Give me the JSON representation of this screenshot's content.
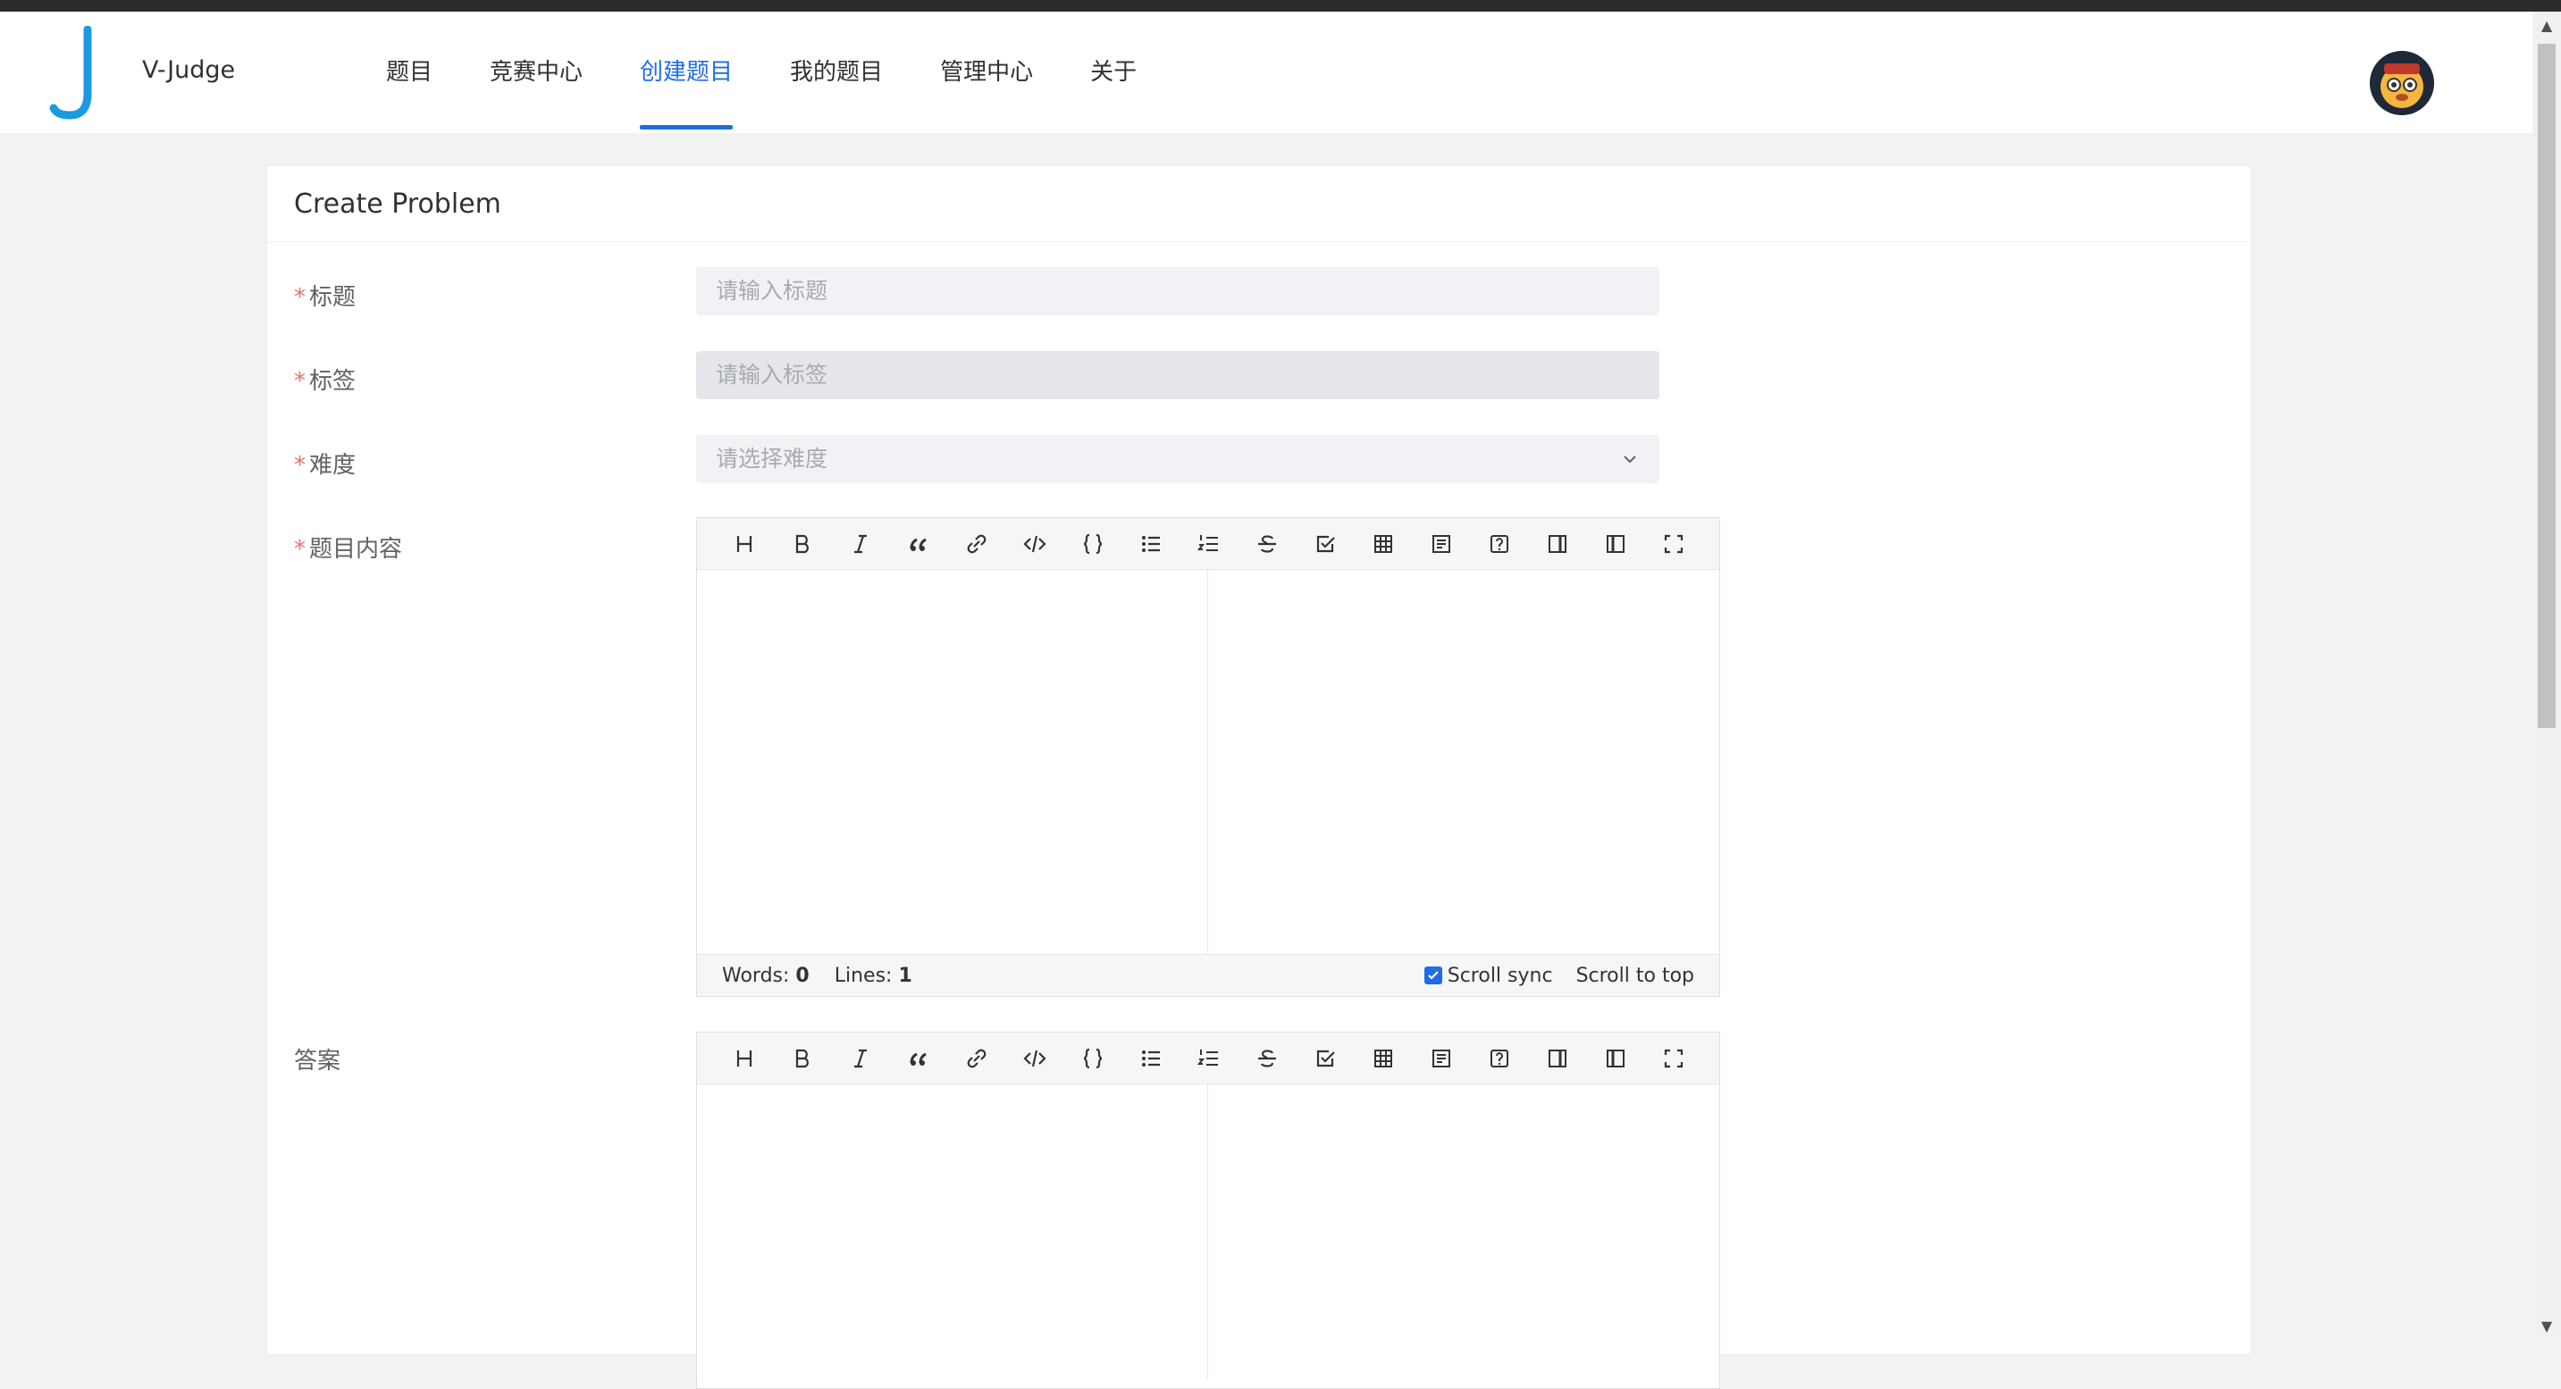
{
  "app": {
    "name": "V-Judge"
  },
  "nav": {
    "items": [
      {
        "label": "题目"
      },
      {
        "label": "竞赛中心"
      },
      {
        "label": "创建题目"
      },
      {
        "label": "我的题目"
      },
      {
        "label": "管理中心"
      },
      {
        "label": "关于"
      }
    ],
    "active": "创建题目"
  },
  "card": {
    "title": "Create Problem"
  },
  "form": {
    "title": {
      "label": "标题",
      "placeholder": "请输入标题",
      "required": true
    },
    "tags": {
      "label": "标签",
      "placeholder": "请输入标签",
      "required": true
    },
    "difficulty": {
      "label": "难度",
      "placeholder": "请选择难度",
      "required": true
    },
    "content": {
      "label": "题目内容",
      "required": true
    },
    "answer": {
      "label": "答案",
      "required": false
    },
    "required_mark": "*"
  },
  "editor": {
    "toolbar": [
      "heading",
      "bold",
      "italic",
      "quote",
      "link",
      "code",
      "code-block",
      "unordered-list",
      "ordered-list",
      "strikethrough",
      "task-list",
      "table",
      "preview",
      "help",
      "side-by-side",
      "catalog",
      "fullscreen"
    ],
    "words_label": "Words:",
    "words_value": "0",
    "lines_label": "Lines:",
    "lines_value": "1",
    "scroll_sync_label": "Scroll sync",
    "scroll_sync_checked": true,
    "scroll_top_label": "Scroll to top"
  },
  "colors": {
    "accent": "#1e6de5",
    "required": "#f56c6c"
  }
}
